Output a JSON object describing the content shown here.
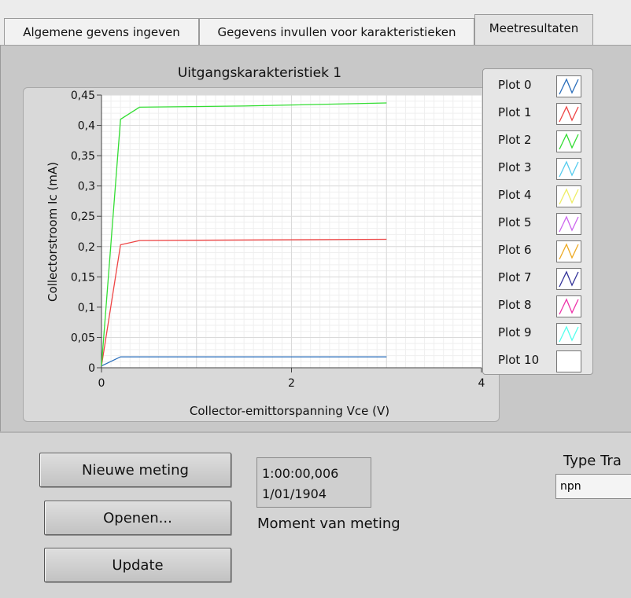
{
  "tabs": [
    {
      "label": "Algemene gevens ingeven",
      "active": false
    },
    {
      "label": "Gegevens  invullen voor karakteristieken",
      "active": false
    },
    {
      "label": "Meetresultaten",
      "active": true
    }
  ],
  "graph": {
    "title": "Uitgangskarakteristiek 1"
  },
  "chart_data": {
    "type": "line",
    "title": "Uitgangskarakteristiek 1",
    "xlabel": "Collector-emittorspanning Vce (V)",
    "ylabel": "Collectorstroom Ic (mA)",
    "xlim": [
      0,
      4
    ],
    "ylim": [
      0,
      0.45
    ],
    "x_ticks": [
      "0",
      "2",
      "4"
    ],
    "y_ticks": [
      "0",
      "0,05",
      "0,1",
      "0,15",
      "0,2",
      "0,25",
      "0,3",
      "0,35",
      "0,4",
      "0,45"
    ],
    "grid": true,
    "legend_position": "right",
    "series": [
      {
        "name": "Plot 0",
        "color": "#2a6ebb",
        "points": [
          [
            0,
            0.003
          ],
          [
            0.2,
            0.018
          ],
          [
            0.4,
            0.018
          ],
          [
            3,
            0.018
          ]
        ]
      },
      {
        "name": "Plot 1",
        "color": "#ee4444",
        "points": [
          [
            0,
            0.003
          ],
          [
            0.2,
            0.203
          ],
          [
            0.4,
            0.21
          ],
          [
            3,
            0.212
          ]
        ]
      },
      {
        "name": "Plot 2",
        "color": "#33dd33",
        "points": [
          [
            0,
            0.003
          ],
          [
            0.2,
            0.41
          ],
          [
            0.4,
            0.43
          ],
          [
            1.5,
            0.432
          ],
          [
            3,
            0.437
          ]
        ]
      }
    ]
  },
  "legend": [
    {
      "label": "Plot 0",
      "color": "#2a6ebb"
    },
    {
      "label": "Plot 1",
      "color": "#ee4444"
    },
    {
      "label": "Plot 2",
      "color": "#33dd33"
    },
    {
      "label": "Plot 3",
      "color": "#55ccee"
    },
    {
      "label": "Plot 4",
      "color": "#eeee66"
    },
    {
      "label": "Plot 5",
      "color": "#cc66ee"
    },
    {
      "label": "Plot 6",
      "color": "#eeaa22"
    },
    {
      "label": "Plot 7",
      "color": "#333399"
    },
    {
      "label": "Plot 8",
      "color": "#ee33aa"
    },
    {
      "label": "Plot 9",
      "color": "#55ffee"
    },
    {
      "label": "Plot 10",
      "color": ""
    }
  ],
  "controls": {
    "new_measurement": "Nieuwe meting",
    "open": "Openen...",
    "update": "Update",
    "time_line1": "1:00:00,006",
    "time_line2": "1/01/1904",
    "time_caption": "Moment van meting",
    "type_label": "Type Tra",
    "type_value": "npn"
  }
}
